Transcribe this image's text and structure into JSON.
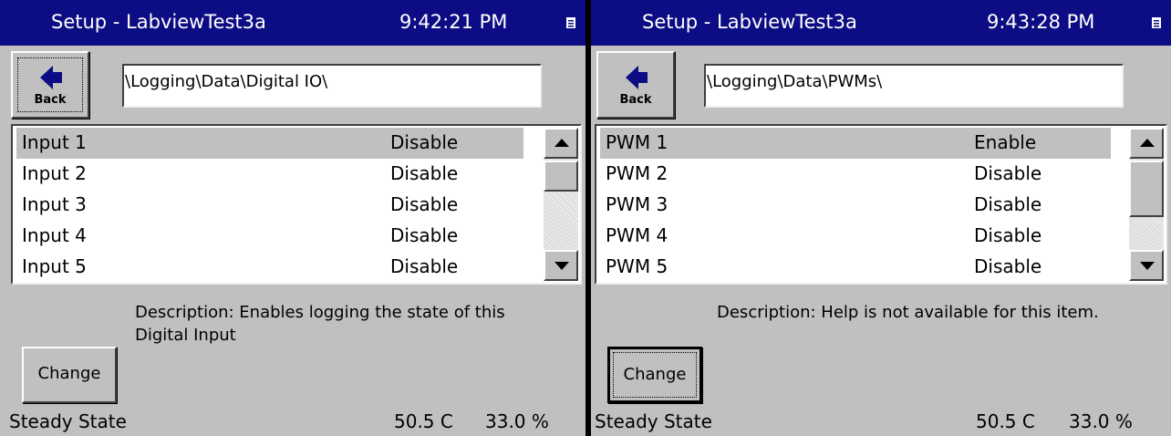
{
  "panels": [
    {
      "title": "Setup - LabviewTest3a",
      "time": "9:42:21 PM",
      "back_label": "Back",
      "path": "\\Logging\\Data\\Digital IO\\",
      "items": [
        {
          "name": "Input 1",
          "value": "Disable"
        },
        {
          "name": "Input 2",
          "value": "Disable"
        },
        {
          "name": "Input 3",
          "value": "Disable"
        },
        {
          "name": "Input 4",
          "value": "Disable"
        },
        {
          "name": "Input 5",
          "value": "Disable"
        }
      ],
      "description_line1": "Description:  Enables logging the state of this",
      "description_line2": "Digital Input",
      "change_label": "Change",
      "status_state": "Steady State",
      "status_temp": "50.5 C",
      "status_percent": "33.0 %"
    },
    {
      "title": "Setup - LabviewTest3a",
      "time": "9:43:28 PM",
      "back_label": "Back",
      "path": "\\Logging\\Data\\PWMs\\",
      "items": [
        {
          "name": "PWM 1",
          "value": "Enable"
        },
        {
          "name": "PWM 2",
          "value": "Disable"
        },
        {
          "name": "PWM 3",
          "value": "Disable"
        },
        {
          "name": "PWM 4",
          "value": "Disable"
        },
        {
          "name": "PWM 5",
          "value": "Disable"
        }
      ],
      "description_line1": "Description:  Help is not available for this item.",
      "description_line2": "",
      "change_label": "Change",
      "status_state": "Steady State",
      "status_temp": "50.5 C",
      "status_percent": "33.0 %"
    }
  ],
  "icons": {
    "back": "left-arrow-icon",
    "titlebar": "window-icon",
    "scroll_up": "up-arrow-icon",
    "scroll_down": "down-arrow-icon"
  },
  "colors": {
    "titlebar": "#0c0c84",
    "face": "#c0c0c0",
    "selection": "#c0c0c0",
    "arrow": "#0c0c84"
  }
}
